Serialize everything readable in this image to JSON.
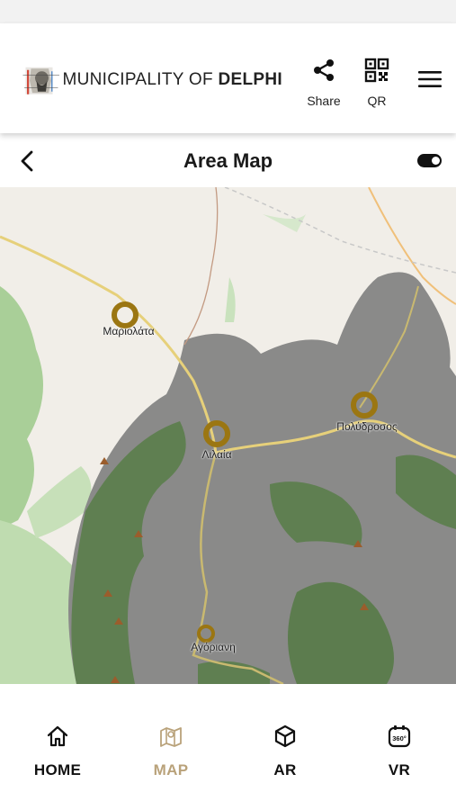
{
  "header": {
    "logo_prefix": "MUNICIPALITY OF",
    "logo_name": "DELPHI",
    "share_label": "Share",
    "qr_label": "QR"
  },
  "title_bar": {
    "title": "Area Map",
    "toggle_on": true
  },
  "map": {
    "markers": [
      {
        "name": "Μαριολάτα"
      },
      {
        "name": "Λιλαία"
      },
      {
        "name": "Πολύδροσος"
      },
      {
        "name": "Αγόριανη"
      }
    ]
  },
  "bottom_nav": {
    "items": [
      {
        "label": "HOME",
        "icon": "home-icon",
        "active": false
      },
      {
        "label": "MAP",
        "icon": "map-icon",
        "active": true
      },
      {
        "label": "AR",
        "icon": "cube-icon",
        "active": false
      },
      {
        "label": "VR",
        "icon": "360-icon",
        "active": false
      }
    ]
  },
  "colors": {
    "accent": "#b9a27a",
    "marker": "#9b7612",
    "nav_inactive": "#111111"
  }
}
